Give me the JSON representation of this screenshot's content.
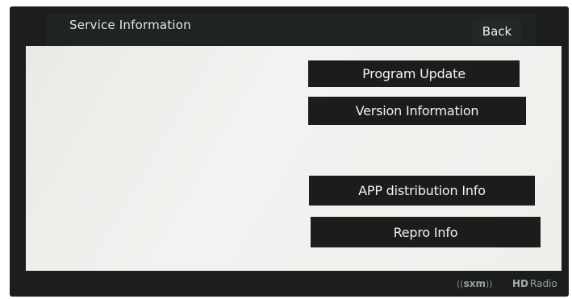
{
  "header": {
    "title": "Service Information",
    "back_label": "Back"
  },
  "menu": {
    "items": [
      {
        "label": "Program Update"
      },
      {
        "label": "Version Information"
      },
      {
        "label": "APP distribution Info"
      },
      {
        "label": "Repro Info"
      }
    ]
  },
  "footer": {
    "sxm_logo": "sxm",
    "hd_radio_logo": "Radio",
    "hd_mark": "HD"
  },
  "colors": {
    "button_bg": "#1b1d1c",
    "panel_bg": "#eef0ec",
    "header_bg": "#1f2421"
  }
}
